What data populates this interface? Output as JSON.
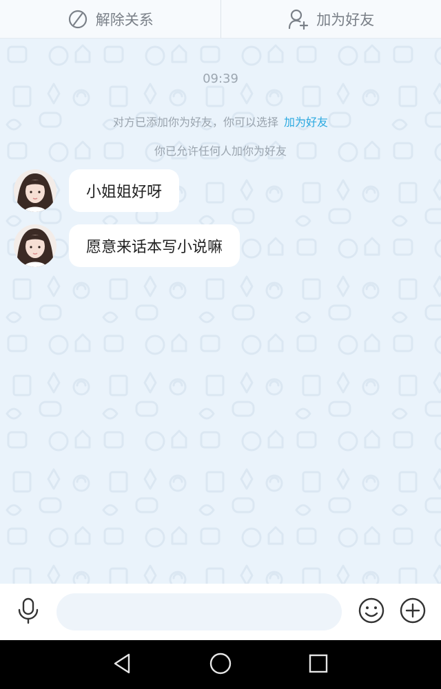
{
  "top_bar": {
    "unfriend_label": "解除关系",
    "add_friend_label": "加为好友"
  },
  "chat": {
    "timestamp": "09:39",
    "system_messages": {
      "added_text": "对方已添加你为好友，你可以选择",
      "added_link": "加为好友",
      "allow_text": "你已允许任何人加你为好友"
    },
    "messages": [
      {
        "text": "小姐姐好呀",
        "from": "other"
      },
      {
        "text": "愿意来话本写小说嘛",
        "from": "other"
      }
    ]
  },
  "input": {
    "value": "",
    "placeholder": ""
  },
  "colors": {
    "chat_background": "#eaf3fb",
    "link": "#2aa9e0",
    "bubble": "#ffffff",
    "nav_bar": "#000000"
  },
  "icons": {
    "unfriend": "slash-circle-icon",
    "add_friend": "person-plus-icon",
    "mic": "microphone-icon",
    "emoji": "smiley-icon",
    "more": "plus-circle-icon",
    "back": "back-triangle-icon",
    "home": "home-circle-icon",
    "recent": "recent-square-icon"
  }
}
